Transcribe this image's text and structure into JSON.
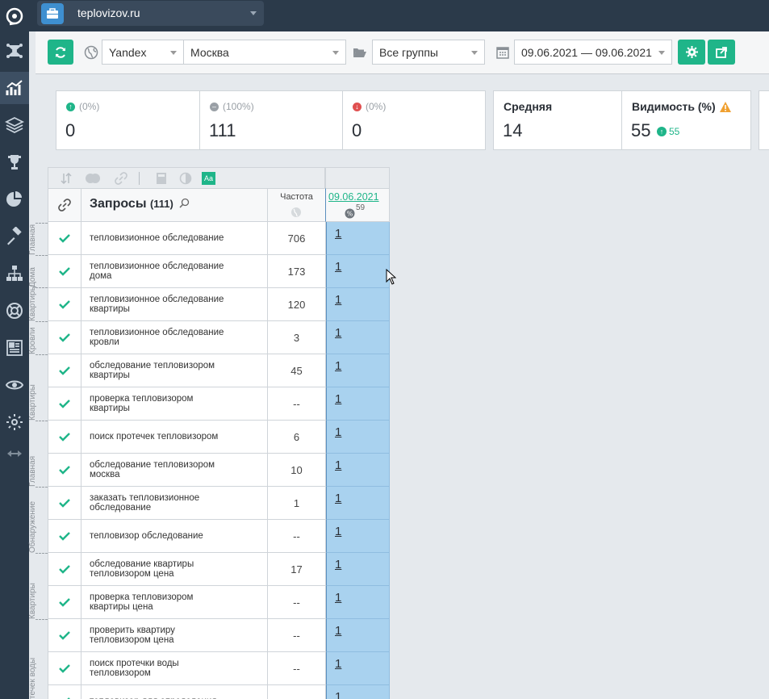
{
  "project": {
    "name": "teplovizov.ru"
  },
  "toolbar": {
    "engine": "Yandex",
    "region": "Москва",
    "groups": "Все группы",
    "date_range": "09.06.2021 — 09.06.2021"
  },
  "stats": {
    "up": {
      "percent": "(0%)",
      "value": "0"
    },
    "same": {
      "percent": "(100%)",
      "value": "111"
    },
    "down": {
      "percent": "(0%)",
      "value": "0"
    },
    "average": {
      "label": "Средняя",
      "value": "14"
    },
    "visibility": {
      "label": "Видимость (%)",
      "value": "55",
      "delta": "55"
    }
  },
  "table": {
    "queries_label": "Запросы",
    "queries_count": "(111)",
    "freq_label": "Частота",
    "date_col": "09.06.2021",
    "date_sub": "59",
    "rows": [
      {
        "q1": "тепловизионное обследование",
        "q2": "",
        "freq": "706",
        "pos": "1"
      },
      {
        "q1": "тепловизионное обследование",
        "q2": "дома",
        "freq": "173",
        "pos": "1"
      },
      {
        "q1": "тепловизионное обследование",
        "q2": "квартиры",
        "freq": "120",
        "pos": "1"
      },
      {
        "q1": "тепловизионное обследование",
        "q2": "кровли",
        "freq": "3",
        "pos": "1"
      },
      {
        "q1": "обследование тепловизором",
        "q2": "квартиры",
        "freq": "45",
        "pos": "1"
      },
      {
        "q1": "проверка тепловизором",
        "q2": "квартиры",
        "freq": "--",
        "pos": "1"
      },
      {
        "q1": "поиск протечек тепловизором",
        "q2": "",
        "freq": "6",
        "pos": "1"
      },
      {
        "q1": "обследование тепловизором",
        "q2": "москва",
        "freq": "10",
        "pos": "1"
      },
      {
        "q1": "заказать тепловизионное",
        "q2": "обследование",
        "freq": "1",
        "pos": "1"
      },
      {
        "q1": "тепловизор обследование",
        "q2": "",
        "freq": "--",
        "pos": "1"
      },
      {
        "q1": "обследование квартиры",
        "q2": "тепловизором цена",
        "freq": "17",
        "pos": "1"
      },
      {
        "q1": "проверка тепловизором",
        "q2": "квартиры цена",
        "freq": "--",
        "pos": "1"
      },
      {
        "q1": "проверить квартиру",
        "q2": "тепловизором цена",
        "freq": "--",
        "pos": "1"
      },
      {
        "q1": "поиск протечки воды",
        "q2": "тепловизором",
        "freq": "--",
        "pos": "1"
      },
      {
        "q1": "тепловизор для определения",
        "q2": "",
        "freq": "",
        "pos": "1"
      }
    ]
  },
  "group_labels": {
    "g1": "Главная",
    "g2": "Дома",
    "g3": "Квартиры",
    "g4": "Кровли",
    "g5": "Квартиры",
    "g6": "Обнаружение",
    "g7": "Главная",
    "g8": "к воды",
    "g9": "Квартиры",
    "g10": "течек воды"
  },
  "colors": {
    "accent": "#1fb589",
    "sidebar": "#2b3a4a",
    "position_cell": "#a9d2ef",
    "warning": "#f0a030"
  }
}
